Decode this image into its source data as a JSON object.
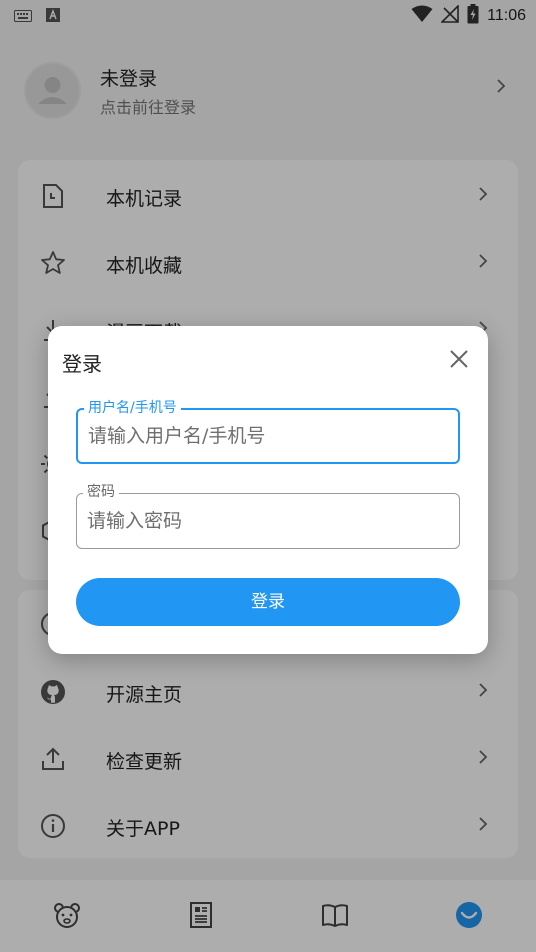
{
  "status_bar": {
    "time": "11:06",
    "icons": [
      "keyboard-icon",
      "a-letter-icon",
      "wifi-icon",
      "no-signal-icon",
      "battery-charging-icon"
    ]
  },
  "profile": {
    "name": "未登录",
    "subtitle": "点击前往登录"
  },
  "menu": {
    "group1": [
      {
        "label": "本机记录",
        "icon": "history-file-icon"
      },
      {
        "label": "本机收藏",
        "icon": "star-icon"
      },
      {
        "label": "漫画下载",
        "icon": "download-icon"
      },
      {
        "label": "",
        "icon": "download-icon"
      },
      {
        "label": "",
        "icon": "settings-sun-icon"
      },
      {
        "label": "",
        "icon": "hexagon-icon"
      }
    ],
    "group2": [
      {
        "label": "",
        "icon": "info-icon"
      },
      {
        "label": "开源主页",
        "icon": "github-icon"
      },
      {
        "label": "检查更新",
        "icon": "upload-icon"
      },
      {
        "label": "关于APP",
        "icon": "info-icon"
      }
    ]
  },
  "bottom_nav": [
    {
      "icon": "bear-face-icon",
      "active": false
    },
    {
      "icon": "newspaper-icon",
      "active": false
    },
    {
      "icon": "book-icon",
      "active": false
    },
    {
      "icon": "smile-face-icon",
      "active": true
    }
  ],
  "dialog": {
    "title": "登录",
    "username": {
      "label": "用户名/手机号",
      "placeholder": "请输入用户名/手机号",
      "value": ""
    },
    "password": {
      "label": "密码",
      "placeholder": "请输入密码",
      "value": ""
    },
    "submit_label": "登录"
  },
  "colors": {
    "accent": "#2196f3",
    "scrim": "rgba(0,0,0,0.32)",
    "background": "#f3f3f3"
  }
}
